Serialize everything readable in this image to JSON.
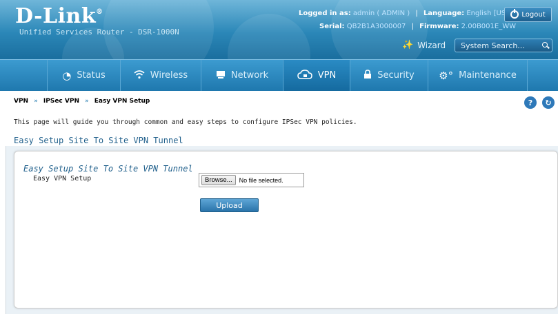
{
  "header": {
    "logo": "D-Link",
    "logo_mark": "®",
    "subtitle": "Unified Services Router - DSR-1000N",
    "logged_in_label": "Logged in as:",
    "logged_in_value": "admin ( ADMIN )",
    "language_label": "Language:",
    "language_value": "English [US]",
    "serial_label": "Serial:",
    "serial_value": "QB2B1A3000007",
    "firmware_label": "Firmware:",
    "firmware_value": "2.00B001E_WW",
    "logout_label": "Logout",
    "wizard_label": "Wizard",
    "search_placeholder": "System Search..."
  },
  "nav": {
    "items": [
      {
        "label": "Status",
        "icon": "dashboard-icon"
      },
      {
        "label": "Wireless",
        "icon": "wifi-icon"
      },
      {
        "label": "Network",
        "icon": "network-icon"
      },
      {
        "label": "VPN",
        "icon": "cloud-lock-icon",
        "active": true
      },
      {
        "label": "Security",
        "icon": "lock-icon"
      },
      {
        "label": "Maintenance",
        "icon": "gears-icon"
      }
    ]
  },
  "breadcrumb": {
    "items": [
      "VPN",
      "IPSec VPN",
      "Easy VPN Setup"
    ],
    "separator": "»"
  },
  "page": {
    "description": "This page will guide you through common and easy steps to configure IPSec VPN policies.",
    "title": "Easy Setup Site To Site VPN Tunnel"
  },
  "form": {
    "section_title": "Easy Setup Site To Site VPN Tunnel",
    "field_label": "Easy VPN Setup",
    "browse_label": "Browse...",
    "file_status": "No file selected.",
    "upload_label": "Upload"
  },
  "colors": {
    "brand_blue": "#1f78ae",
    "title_blue": "#1f5f8b"
  }
}
